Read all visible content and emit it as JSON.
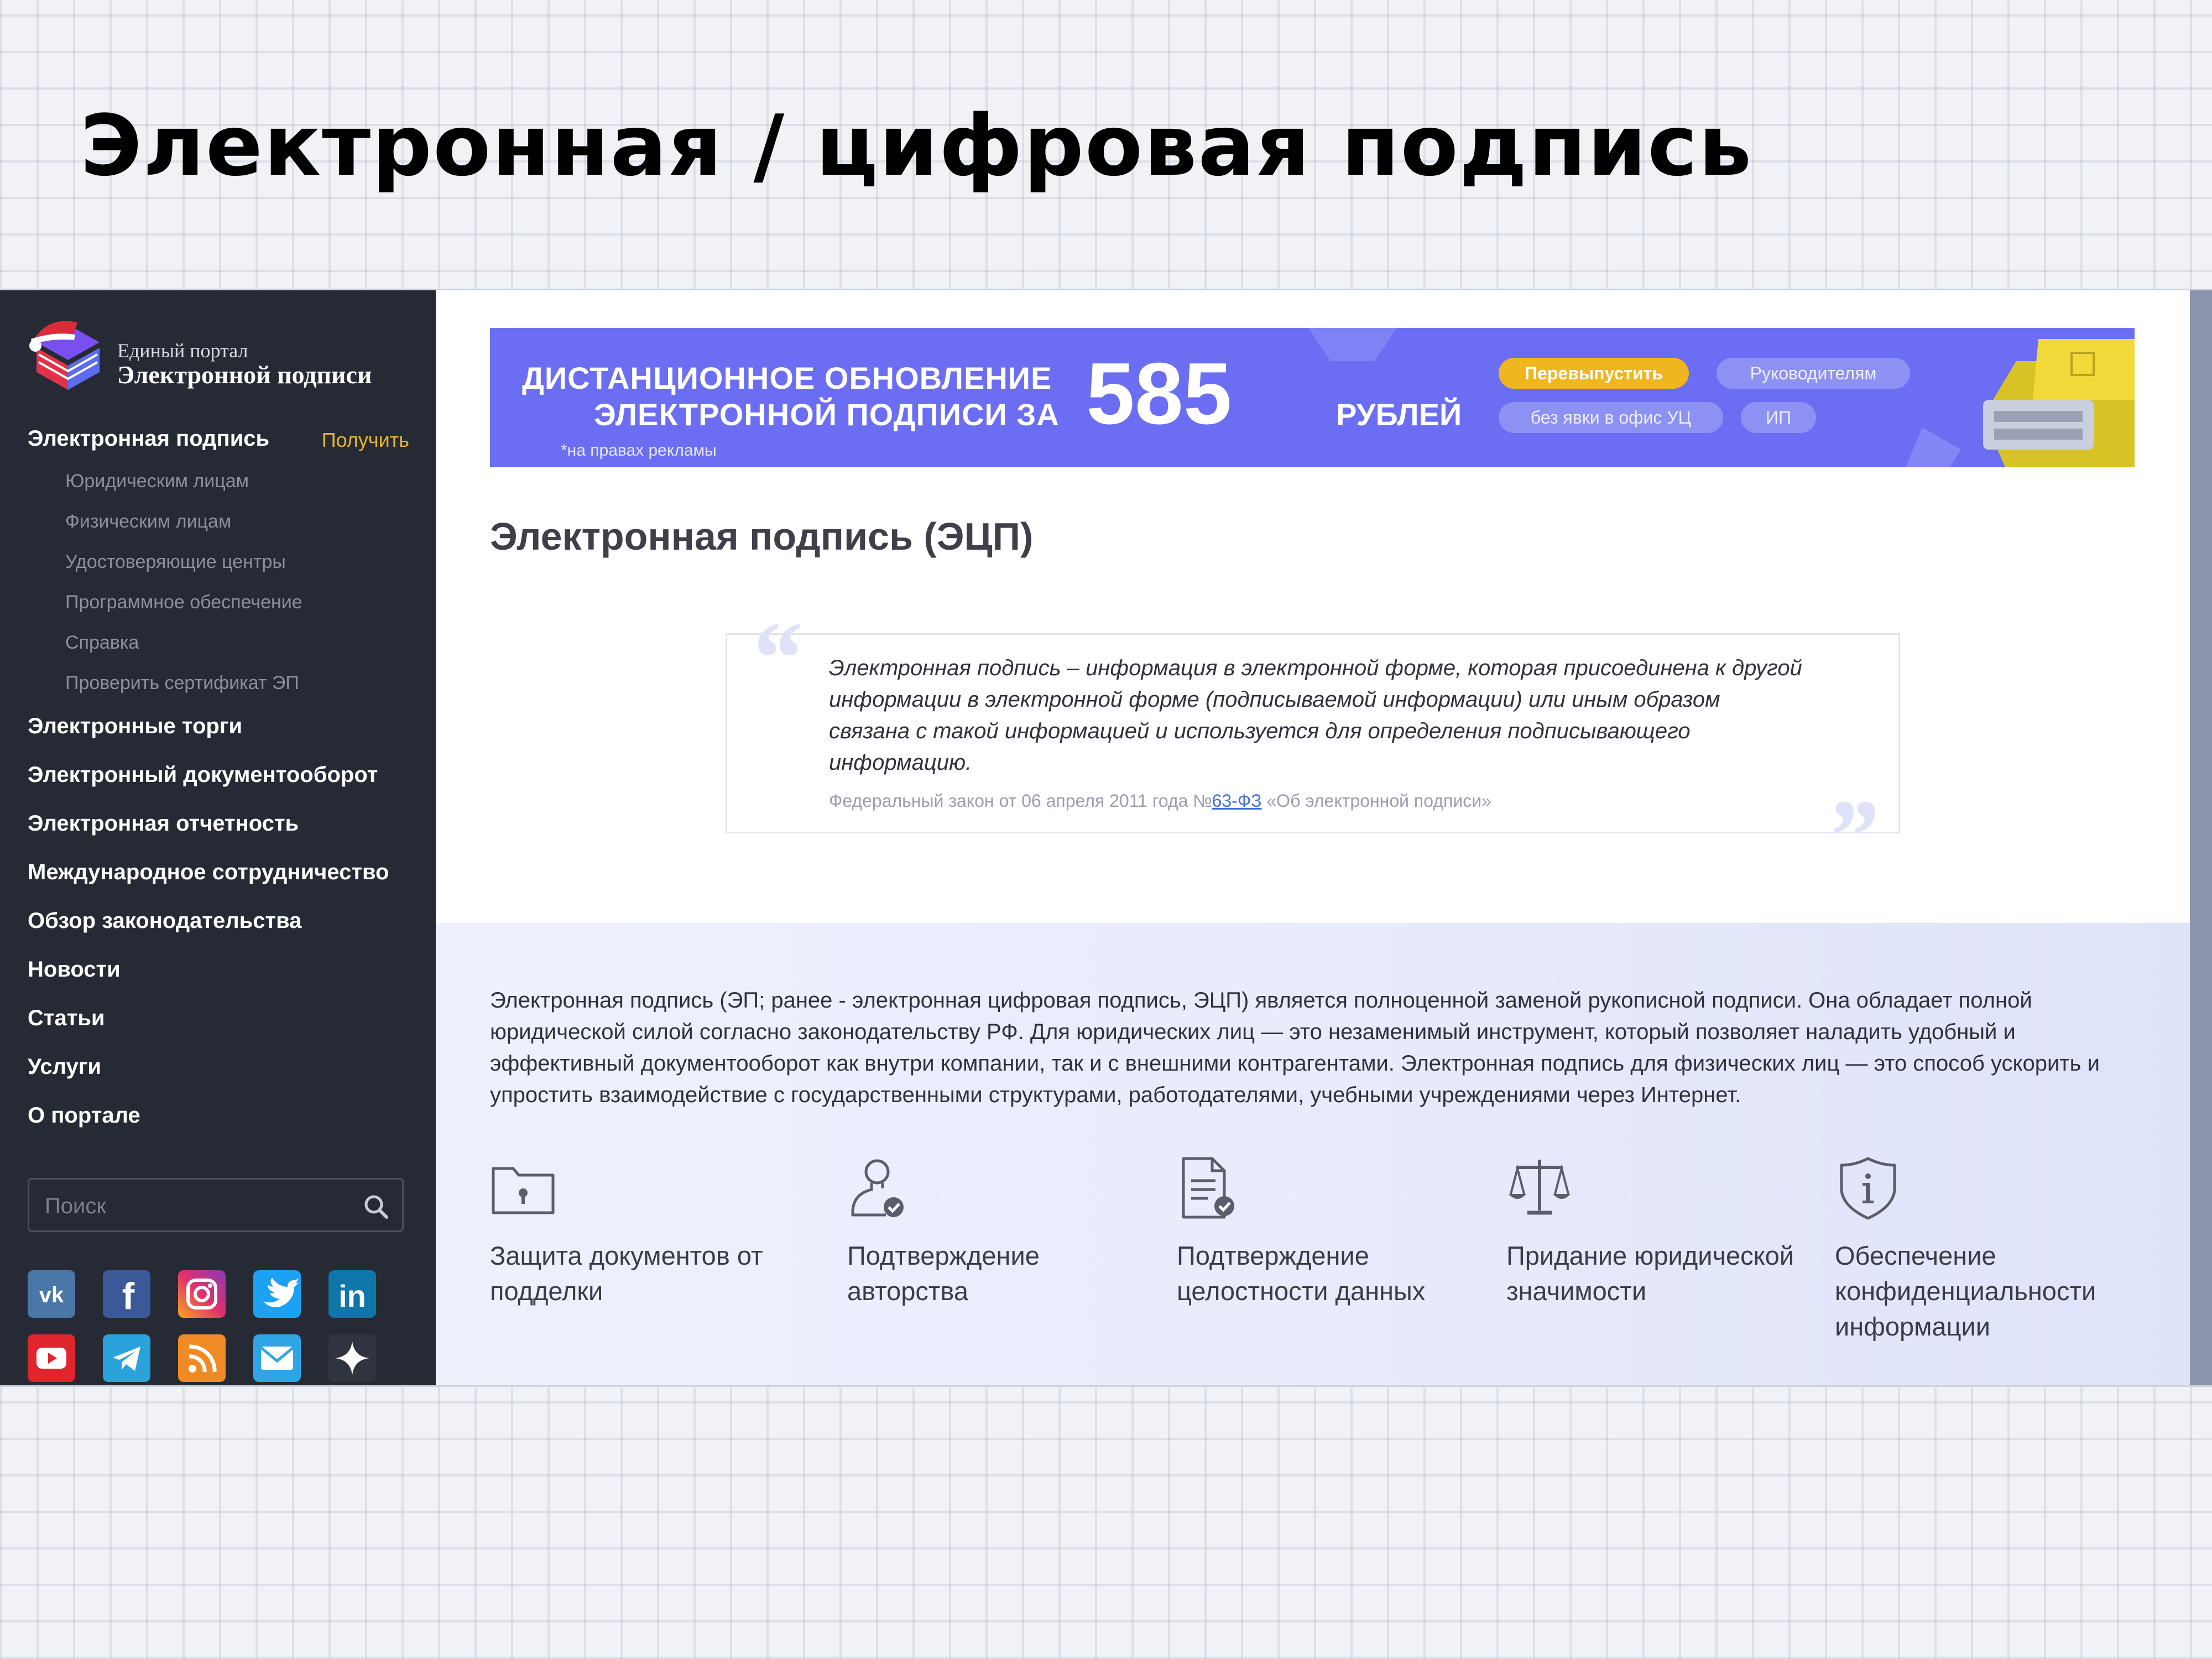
{
  "slide": {
    "title": "Электронная / цифровая подпись"
  },
  "sidebar": {
    "logo_line1": "Единый портал",
    "logo_line2": "Электронной подписи",
    "primary": {
      "label": "Электронная подпись",
      "action": "Получить"
    },
    "subitems": [
      {
        "label": "Юридическим лицам"
      },
      {
        "label": "Физическим лицам"
      },
      {
        "label": "Удостоверяющие центры"
      },
      {
        "label": "Программное обеспечение"
      },
      {
        "label": "Справка"
      },
      {
        "label": "Проверить сертификат ЭП"
      }
    ],
    "items": [
      {
        "label": "Электронные торги"
      },
      {
        "label": "Электронный документооборот"
      },
      {
        "label": "Электронная отчетность"
      },
      {
        "label": "Международное сотрудничество"
      },
      {
        "label": "Обзор законодательства"
      },
      {
        "label": "Новости"
      },
      {
        "label": "Статьи"
      },
      {
        "label": "Услуги"
      },
      {
        "label": "О портале"
      }
    ],
    "search_placeholder": "Поиск",
    "social": [
      "vk-icon",
      "facebook-icon",
      "instagram-icon",
      "twitter-icon",
      "linkedin-icon",
      "youtube-icon",
      "telegram-icon",
      "rss-icon",
      "mail-icon",
      "zen-icon"
    ]
  },
  "banner": {
    "line1": "ДИСТАНЦИОННОЕ ОБНОВЛЕНИЕ",
    "line2": "ЭЛЕКТРОННОЙ ПОДПИСИ ЗА",
    "amount": "585",
    "currency": "РУБЛЕЙ",
    "ad_note": "*на правах рекламы",
    "pills": [
      "Перевыпустить",
      "Руководителям",
      "без явки в офис УЦ",
      "ИП"
    ],
    "colors": {
      "background": "#6b6ef2",
      "highlight_pill": "#efb61d"
    }
  },
  "main": {
    "heading": "Электронная подпись (ЭЦП)",
    "quote": {
      "text": "Электронная подпись – информация в электронной форме, которая присоединена к другой информации в электронной форме (подписываемой информации) или иным образом связана с такой информацией и используется для определения подписывающего информацию.",
      "source_prefix": "Федеральный закон от 06 апреля 2011 года №",
      "source_link": "63-ФЗ",
      "source_suffix": " «Об электронной подписи»"
    },
    "intro": "Электронная подпись (ЭП; ранее - электронная цифровая подпись, ЭЦП) является полноценной заменой рукописной подписи. Она обладает полной юридической силой согласно законодательству РФ. Для юридических лиц — это незаменимый инструмент, который позволяет наладить удобный и эффективный документооборот как внутри компании, так и с внешними контрагентами. Электронная подпись для физических лиц — это способ ускорить и упростить взаимодействие с государственными структурами, работодателями, учебными учреждениями через Интернет.",
    "features": [
      {
        "icon": "folder-lock-icon",
        "label": "Защита документов от подделки"
      },
      {
        "icon": "user-check-icon",
        "label": "Подтверждение авторства"
      },
      {
        "icon": "document-check-icon",
        "label": "Подтверждение целостности данных"
      },
      {
        "icon": "scales-icon",
        "label": "Придание юридической значимости"
      },
      {
        "icon": "shield-info-icon",
        "label": "Обеспечение конфиденциальности информации"
      }
    ]
  }
}
